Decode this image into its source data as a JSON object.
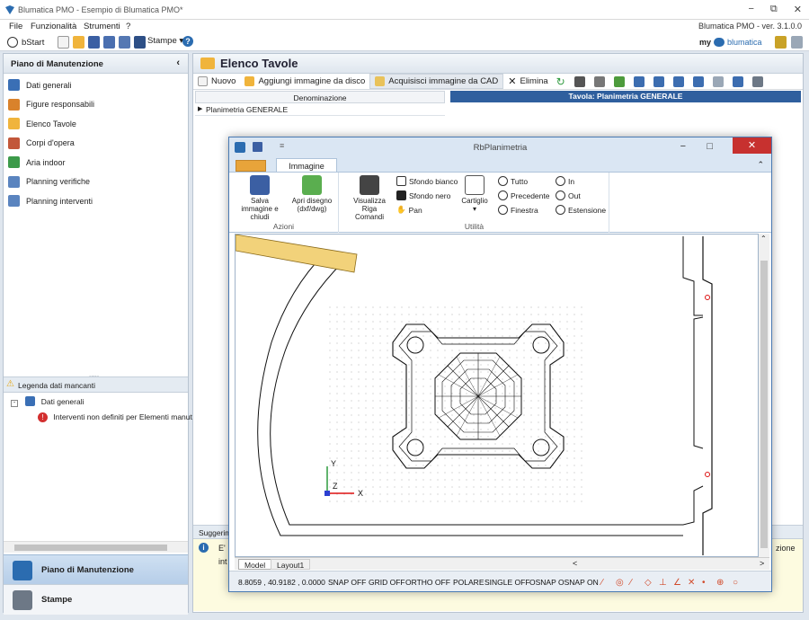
{
  "window": {
    "title": "Blumatica PMO - Esempio di Blumatica PMO*",
    "version": "Blumatica PMO - ver. 3.1.0.0"
  },
  "menu": [
    "File",
    "Funzionalità",
    "Strumenti",
    "?"
  ],
  "toolbar": {
    "bstart": "bStart",
    "stampe": "Stampe",
    "brand_my": "my",
    "brand_name": "blumatica"
  },
  "left_panel": {
    "title": "Piano di Manutenzione",
    "items": [
      {
        "label": "Dati generali",
        "icon": "building-icon",
        "color": "#3a6fb5"
      },
      {
        "label": "Figure responsabili",
        "icon": "people-icon",
        "color": "#d9822b"
      },
      {
        "label": "Elenco Tavole",
        "icon": "folder-icon",
        "color": "#f0b43c"
      },
      {
        "label": "Corpi d'opera",
        "icon": "box-icon",
        "color": "#c2573a"
      },
      {
        "label": "Aria indoor",
        "icon": "house-icon",
        "color": "#3c9a4a"
      },
      {
        "label": "Planning verifiche",
        "icon": "calendar-icon",
        "color": "#5a84bf"
      },
      {
        "label": "Planning interventi",
        "icon": "calendar-icon",
        "color": "#5a84bf"
      }
    ],
    "legend": {
      "title": "Legenda dati mancanti",
      "node": "Dati generali",
      "child": "Interventi non definiti per Elementi manute"
    },
    "bottom_buttons": [
      "Piano di Manutenzione",
      "Stampe"
    ]
  },
  "main": {
    "title": "Elenco Tavole",
    "toolbar": [
      "Nuovo",
      "Aggiungi immagine da disco",
      "Acquisisci immagine da CAD",
      "Elimina"
    ],
    "grid_header": "Denominazione",
    "rows": [
      "Planimetria GENERALE"
    ],
    "preview_title": "Tavola: Planimetria GENERALE",
    "suggest_title": "Suggerim",
    "suggest_text_left": "E'",
    "suggest_text_left2": "int",
    "suggest_text_right": "zione"
  },
  "dialog": {
    "title": "RbPlanimetria",
    "tab": "Immagine tavola",
    "groups": {
      "azioni": "Azioni",
      "utilita": "Utilità"
    },
    "azioni": {
      "save": "Salva immagine e chiudi",
      "open": "Apri disegno (dxf/dwg)"
    },
    "utilita": {
      "visualizza": "Visualizza Riga Comandi",
      "sfondo_bianco": "Sfondo bianco",
      "sfondo_nero": "Sfondo nero",
      "pan": "Pan",
      "cartiglio": "Cartiglio",
      "tutto": "Tutto",
      "precedente": "Precedente",
      "finestra": "Finestra",
      "in": "In",
      "out": "Out",
      "estensione": "Estensione"
    },
    "layout_tabs": [
      "Model",
      "Layout1"
    ],
    "status": {
      "coords": "8.8059 , 40.9182 , 0.0000",
      "toggles": [
        "SNAP OFF",
        "GRID OFF",
        "ORTHO OFF",
        "POLARE",
        "SINGLE OFF",
        "OSNAP",
        "OSNAP ON"
      ]
    },
    "axis_labels": {
      "x": "X",
      "y": "Y",
      "z": "Z"
    }
  }
}
